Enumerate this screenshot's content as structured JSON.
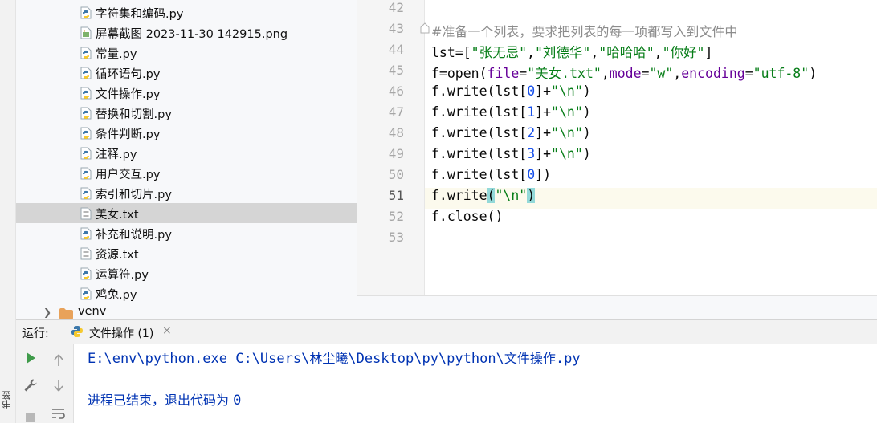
{
  "sidebar": {
    "bookmark_label": "书签"
  },
  "project_tree": {
    "files": [
      {
        "name": "字符集和编码.py",
        "type": "py"
      },
      {
        "name": "屏幕截图 2023-11-30 142915.png",
        "type": "png"
      },
      {
        "name": "常量.py",
        "type": "py"
      },
      {
        "name": "循环语句.py",
        "type": "py"
      },
      {
        "name": "文件操作.py",
        "type": "py"
      },
      {
        "name": "替换和切割.py",
        "type": "py"
      },
      {
        "name": "条件判断.py",
        "type": "py"
      },
      {
        "name": "注释.py",
        "type": "py"
      },
      {
        "name": "用户交互.py",
        "type": "py"
      },
      {
        "name": "索引和切片.py",
        "type": "py"
      },
      {
        "name": "美女.txt",
        "type": "txt",
        "selected": true
      },
      {
        "name": "补充和说明.py",
        "type": "py"
      },
      {
        "name": "资源.txt",
        "type": "txt"
      },
      {
        "name": "运算符.py",
        "type": "py"
      },
      {
        "name": "鸡兔.py",
        "type": "py"
      }
    ],
    "venv_folder": "venv"
  },
  "editor": {
    "line_numbers": [
      "42",
      "43",
      "44",
      "45",
      "46",
      "47",
      "48",
      "49",
      "50",
      "51",
      "52",
      "53"
    ],
    "current_line": "51",
    "code": {
      "l43_comment": "#准备一个列表，要求把列表的每一项都写入到文件中",
      "l44_a": "lst=[",
      "l44_s1": "\"张无忌\"",
      "l44_c1": ",",
      "l44_s2": "\"刘德华\"",
      "l44_c2": ",",
      "l44_s3": "\"哈哈哈\"",
      "l44_c3": ",",
      "l44_s4": "\"你好\"",
      "l44_b": "]",
      "l45_a": "f=open(",
      "l45_p1": "file",
      "l45_eq1": "=",
      "l45_s1": "\"美女.txt\"",
      "l45_c1": ",",
      "l45_p2": "mode",
      "l45_eq2": "=",
      "l45_s2": "\"w\"",
      "l45_c2": ",",
      "l45_p3": "encoding",
      "l45_eq3": "=",
      "l45_s3": "\"utf-8\"",
      "l45_b": ")",
      "write_prefix": "f.write(lst[",
      "idx": [
        "0",
        "1",
        "2",
        "3"
      ],
      "write_mid": "]+",
      "newline_str": "\"\\n\"",
      "write_end": ")",
      "l50_a": "f.write(lst[",
      "l50_n": "0",
      "l50_b": "])",
      "l51_a": "f.write",
      "l51_p1": "(",
      "l51_s": "\"\\n\"",
      "l51_p2": ")",
      "l52": "f.close()"
    }
  },
  "run_panel": {
    "title": "运行:",
    "tab_label": "文件操作 (1)",
    "tab_close": "×",
    "console": {
      "cmd_path": "E:\\env\\python.exe C:\\Users\\",
      "cmd_user": "林尘曦",
      "cmd_path2": "\\Desktop\\py\\python\\",
      "cmd_file": "文件操作",
      "cmd_ext": ".py",
      "exit_text": "进程已结束，退出代码为 ",
      "exit_code": "0"
    }
  },
  "colors": {
    "string": "#067d17",
    "param": "#660099",
    "number": "#1750eb",
    "comment": "#8c8c8c",
    "console_text": "#0033b3",
    "selected_row": "#d5d5d5",
    "current_line": "#fcfaed",
    "bracket_highlight": "#93d9d9"
  }
}
